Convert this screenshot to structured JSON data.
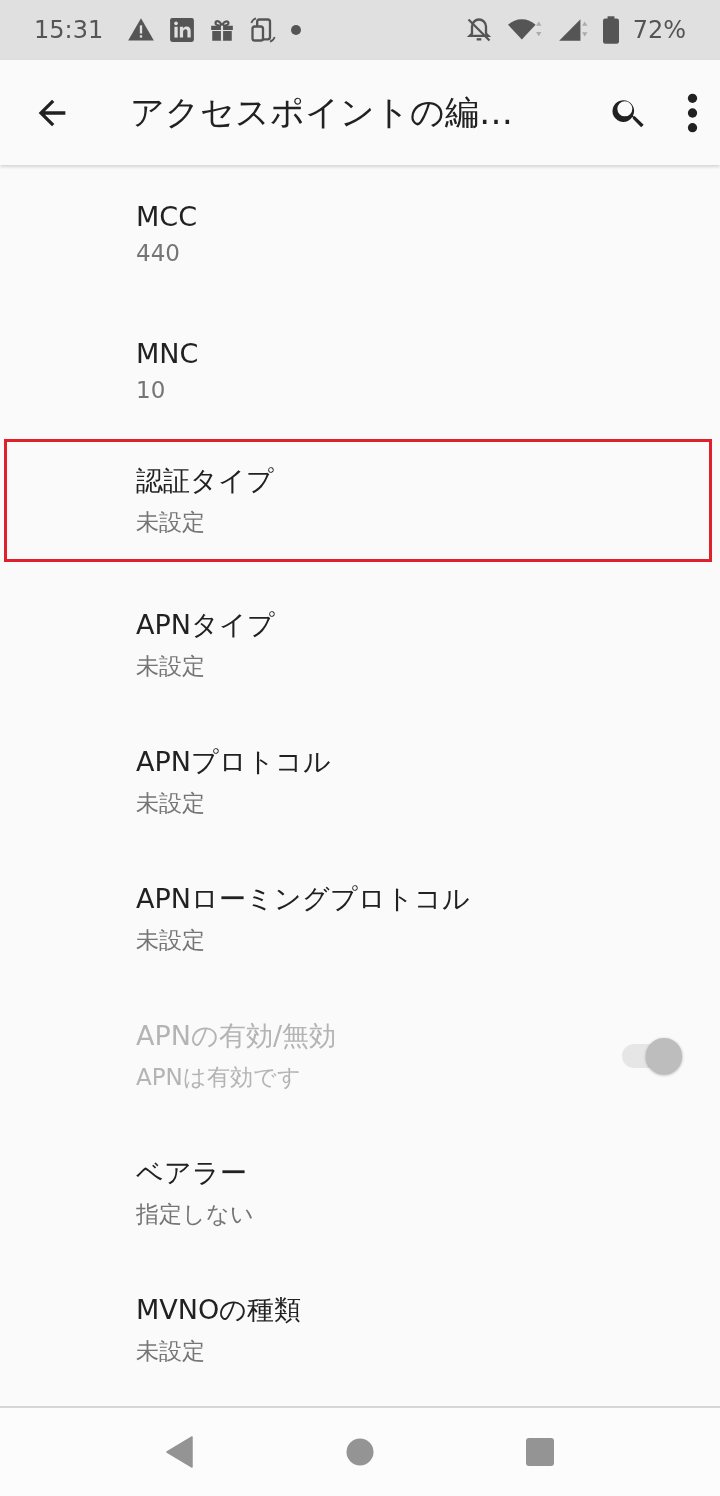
{
  "status_bar": {
    "time": "15:31",
    "battery": "72%"
  },
  "toolbar": {
    "title": "アクセスポイントの編…"
  },
  "settings": [
    {
      "kind": "text",
      "title": "MCC",
      "summary": "440",
      "highlighted": false,
      "disabled": false
    },
    {
      "kind": "text",
      "title": "MNC",
      "summary": "10",
      "highlighted": false,
      "disabled": false
    },
    {
      "kind": "text",
      "title": "認証タイプ",
      "summary": "未設定",
      "highlighted": true,
      "disabled": false
    },
    {
      "kind": "text",
      "title": "APNタイプ",
      "summary": "未設定",
      "highlighted": false,
      "disabled": false
    },
    {
      "kind": "text",
      "title": "APNプロトコル",
      "summary": "未設定",
      "highlighted": false,
      "disabled": false
    },
    {
      "kind": "text",
      "title": "APNローミングプロトコル",
      "summary": "未設定",
      "highlighted": false,
      "disabled": false
    },
    {
      "kind": "switch",
      "title": "APNの有効/無効",
      "summary": "APNは有効です",
      "highlighted": false,
      "disabled": true,
      "on": true
    },
    {
      "kind": "text",
      "title": "ベアラー",
      "summary": "指定しない",
      "highlighted": false,
      "disabled": false
    },
    {
      "kind": "text",
      "title": "MVNOの種類",
      "summary": "未設定",
      "highlighted": false,
      "disabled": false
    }
  ]
}
